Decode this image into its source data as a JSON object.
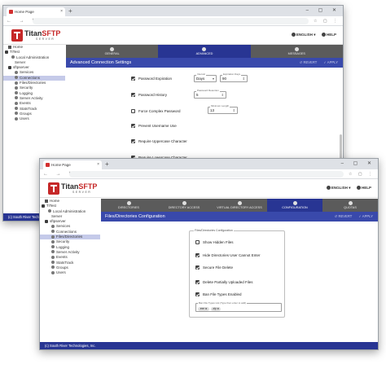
{
  "browser": {
    "tab_title": "Home Page",
    "tab_close": "×",
    "new_tab": "+",
    "window_controls": "– ▢ ✕",
    "nav_icons": "← → ↻",
    "bar_icons": "☆ ▢ ⋮"
  },
  "header": {
    "logo_main": "Titan",
    "logo_accent": "SFTP",
    "logo_sub": "SERVER",
    "language": "ENGLISH",
    "language_caret": "▾",
    "help": "HELP"
  },
  "window1": {
    "tree": [
      {
        "label": "Home",
        "icon": "home-icon",
        "indent": 1
      },
      {
        "label": "TiTest",
        "icon": "server-group-icon",
        "indent": 0
      },
      {
        "label": "Local Administration",
        "icon": "admin-icon",
        "indent": 2
      },
      {
        "label": "Server",
        "icon": "",
        "indent": 3
      },
      {
        "label": "sftpserver",
        "icon": "server-icon",
        "indent": 1
      },
      {
        "label": "Services",
        "icon": "gear-icon",
        "indent": 3
      },
      {
        "label": "Connections",
        "icon": "gear-icon",
        "indent": 3
      },
      {
        "label": "Files/Directories",
        "icon": "gear-icon",
        "indent": 3
      },
      {
        "label": "Security",
        "icon": "gear-icon",
        "indent": 3
      },
      {
        "label": "Logging",
        "icon": "gear-icon",
        "indent": 3
      },
      {
        "label": "Server Activity",
        "icon": "gear-icon",
        "indent": 3
      },
      {
        "label": "Events",
        "icon": "gear-icon",
        "indent": 3
      },
      {
        "label": "StatsTrack",
        "icon": "gear-icon",
        "indent": 3
      },
      {
        "label": "Groups",
        "icon": "gear-icon",
        "indent": 3
      },
      {
        "label": "Users",
        "icon": "gear-icon",
        "indent": 3
      }
    ],
    "selected_index": 6,
    "footer": "(c) South River Tech",
    "tabs": [
      "GENERAL",
      "ADVANCED",
      "MESSAGES"
    ],
    "active_tab": 1,
    "section_title": "Advanced Connection Settings",
    "revert": "↺ REVERT",
    "apply": "✓ APPLY",
    "options": [
      {
        "label": "Password Expiration",
        "checked": true
      },
      {
        "label": "Password History",
        "checked": true
      },
      {
        "label": "Force Complex Password",
        "checked": false
      },
      {
        "label": "Prevent Username Use",
        "checked": true
      },
      {
        "label": "Require Uppercase Character",
        "checked": true
      },
      {
        "label": "Require Lowercase Character",
        "checked": true
      }
    ],
    "fields": {
      "interval_label": "Interval",
      "interval_value": "Days",
      "expiration_label": "Expiration Days",
      "expiration_value": "90",
      "retention_label": "Password Retention",
      "retention_value": "5",
      "min_length_label": "Minimum Length",
      "min_length_value": "13"
    }
  },
  "window2": {
    "tree": [
      {
        "label": "Home",
        "icon": "home-icon",
        "indent": 1
      },
      {
        "label": "TiTest",
        "icon": "server-group-icon",
        "indent": 0
      },
      {
        "label": "Local Administration",
        "icon": "admin-icon",
        "indent": 2
      },
      {
        "label": "Server",
        "icon": "",
        "indent": 3
      },
      {
        "label": "sftpserver",
        "icon": "server-icon",
        "indent": 1
      },
      {
        "label": "Services",
        "icon": "gear-icon",
        "indent": 3
      },
      {
        "label": "Connections",
        "icon": "gear-icon",
        "indent": 3
      },
      {
        "label": "Files/Directories",
        "icon": "gear-icon",
        "indent": 3
      },
      {
        "label": "Security",
        "icon": "gear-icon",
        "indent": 3
      },
      {
        "label": "Logging",
        "icon": "gear-icon",
        "indent": 3
      },
      {
        "label": "Server Activity",
        "icon": "gear-icon",
        "indent": 3
      },
      {
        "label": "Events",
        "icon": "gear-icon",
        "indent": 3
      },
      {
        "label": "StatsTrack",
        "icon": "gear-icon",
        "indent": 3
      },
      {
        "label": "Groups",
        "icon": "gear-icon",
        "indent": 3
      },
      {
        "label": "Users",
        "icon": "gear-icon",
        "indent": 3
      }
    ],
    "selected_index": 7,
    "footer": "(c) South River Technologies, Inc.",
    "tabs": [
      "DIRECTORIES",
      "DIRECTORY ACCESS",
      "VIRTUAL DIRECTORY ACCESS",
      "CONFIGURATION",
      "QUOTAS"
    ],
    "active_tab": 3,
    "section_title": "Files/Directories Configuration",
    "revert": "↺ REVERT",
    "apply": "✓ APPLY",
    "group_label": "Files/Directories Configuration",
    "options": [
      {
        "label": "Show Hidden Files",
        "checked": false
      },
      {
        "label": "Hide Directories User Cannot Enter",
        "checked": true
      },
      {
        "label": "Secure File Delete",
        "checked": true
      },
      {
        "label": "Delete Partially Uploaded Files",
        "checked": true
      },
      {
        "label": "Ban File Types Enabled",
        "checked": true
      }
    ],
    "ban_list_label": "Ban File Types List (Type then enter to add)",
    "ban_chips": [
      ".exe ⊗",
      ".zip ⊗"
    ]
  },
  "colors": {
    "brand_red": "#c62828",
    "active_tab": "#283593",
    "section_bar": "#3949ab",
    "tab_strip": "#5b5b5b"
  }
}
